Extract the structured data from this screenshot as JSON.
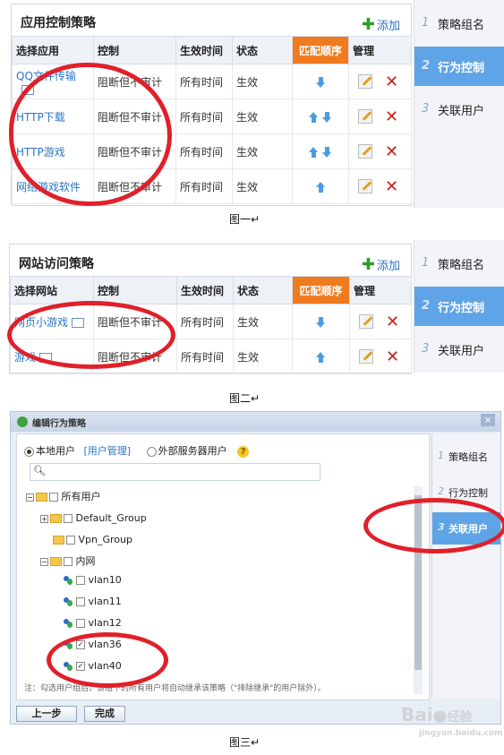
{
  "fig1": {
    "title": "应用控制策略",
    "add_label": "添加",
    "headers": [
      "选择应用",
      "控制",
      "生效时间",
      "状态",
      "匹配顺序",
      "管理"
    ],
    "rows": [
      {
        "app": "QQ文件传输",
        "control": "阻断但不审计",
        "time": "所有时间",
        "status": "生效",
        "order": "down"
      },
      {
        "app": "HTTP下载",
        "control": "阻断但不审计",
        "time": "所有时间",
        "status": "生效",
        "order": "updown"
      },
      {
        "app": "HTTP游戏",
        "control": "阻断但不审计",
        "time": "所有时间",
        "status": "生效",
        "order": "updown"
      },
      {
        "app": "网络游戏软件",
        "control": "阻断但不审计",
        "time": "所有时间",
        "status": "生效",
        "order": "up"
      }
    ],
    "caption": "图一↵"
  },
  "fig2": {
    "title": "网站访问策略",
    "add_label": "添加",
    "headers": [
      "选择网站",
      "控制",
      "生效时间",
      "状态",
      "匹配顺序",
      "管理"
    ],
    "rows": [
      {
        "site": "网页小游戏",
        "control": "阻断但不审计",
        "time": "所有时间",
        "status": "生效",
        "order": "down"
      },
      {
        "site": "游戏",
        "control": "阻断但不审计",
        "time": "所有时间",
        "status": "生效",
        "order": "up"
      }
    ],
    "caption": "图二↵"
  },
  "sidebar": {
    "items": [
      {
        "num": "1",
        "label": "策略组名"
      },
      {
        "num": "2",
        "label": "行为控制"
      },
      {
        "num": "3",
        "label": "关联用户"
      }
    ]
  },
  "fig3": {
    "dialog_title": "编辑行为策略",
    "close_label": "×",
    "radio_local": "本地用户",
    "user_mgmt_link": "[用户管理]",
    "radio_external": "外部服务器用户",
    "help_label": "?",
    "tree": {
      "root": "所有用户",
      "groups": [
        "Default_Group",
        "Vpn_Group",
        "内网"
      ],
      "inner": [
        "vlan10",
        "vlan11",
        "vlan12",
        "vlan36",
        "vlan40"
      ]
    },
    "note": "注：勾选用户组后，该组下的所有用户将自动继承该策略（\"排除继承\"的用户除外）。",
    "btn_prev": "上一步",
    "btn_done": "完成",
    "caption": "图三↵"
  },
  "watermark": {
    "brand": "Bai",
    "brand2": "经验",
    "url": "jingyan.baidu.com"
  }
}
